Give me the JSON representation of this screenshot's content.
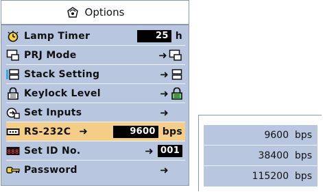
{
  "menu": {
    "title": "Options",
    "rows": [
      {
        "label": "Lamp Timer",
        "value": "25",
        "unit": "h",
        "icon": "lamp-timer-icon"
      },
      {
        "label": "PRJ Mode",
        "arrow": "➜",
        "icon": "prj-mode-icon"
      },
      {
        "label": "Stack Setting",
        "arrow": "➜",
        "icon": "stack-setting-icon"
      },
      {
        "label": "Keylock Level",
        "arrow": "➜",
        "icon": "keylock-icon"
      },
      {
        "label": "Set Inputs",
        "arrow": "➜",
        "icon": "set-inputs-icon"
      },
      {
        "label": "RS-232C",
        "arrow": "➜",
        "value": "9600",
        "unit": "bps",
        "icon": "rs232c-icon"
      },
      {
        "label": "Set ID No.",
        "arrow": "➜",
        "value": "001",
        "icon": "set-id-icon"
      },
      {
        "label": "Password",
        "arrow": "➜",
        "icon": "password-key-icon"
      }
    ]
  },
  "submenu": {
    "options": [
      {
        "value": "9600",
        "unit": "bps"
      },
      {
        "value": "38400",
        "unit": "bps"
      },
      {
        "value": "115200",
        "unit": "bps"
      }
    ]
  },
  "colors": {
    "panel": "#b9c6df",
    "selected": "#f4cd86",
    "border": "#8a97b4"
  }
}
